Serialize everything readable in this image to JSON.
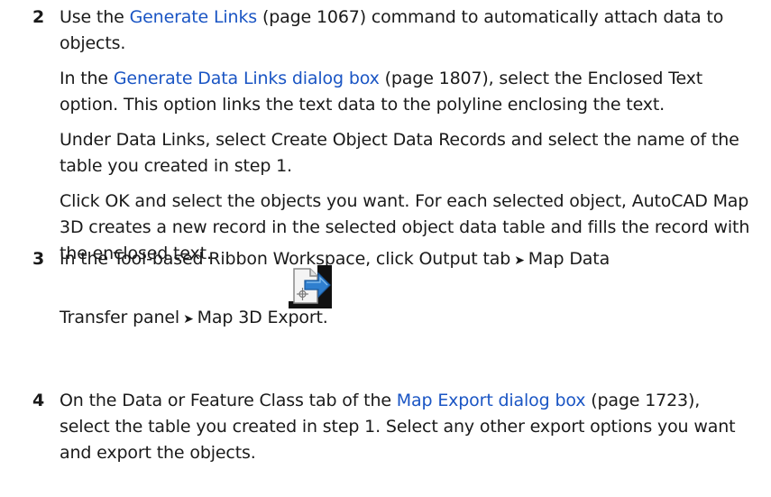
{
  "steps": [
    {
      "number": "2",
      "p1": {
        "t1": "Use the ",
        "link": "Generate Links",
        "t2": " (page 1067) command to automatically attach data to objects."
      },
      "p2": {
        "t1": "In the ",
        "link": "Generate Data Links dialog box",
        "t2": " (page 1807), select the Enclosed Text option. This option links the text data to the polyline enclosing the text."
      },
      "p3": "Under Data Links, select Create Object Data Records and select the name of the table you created in step 1.",
      "p4": "Click OK and select the objects you want. For each selected object, AutoCAD Map 3D creates a new record in the selected object data table and fills the record with the enclosed text."
    },
    {
      "number": "3",
      "line1_a": "In the Tool-based Ribbon Workspace, click Output tab",
      "line1_b": "Map Data",
      "line2_a": "Transfer panel",
      "line2_b": "Map 3D Export.",
      "arrow": "➤",
      "icon": "map-3d-export-icon"
    },
    {
      "number": "4",
      "t1": "On the Data or Feature Class tab of the ",
      "link": "Map Export dialog box",
      "t2": " (page 1723), select the table you created in step 1. Select any other export options you want and export the objects."
    }
  ]
}
